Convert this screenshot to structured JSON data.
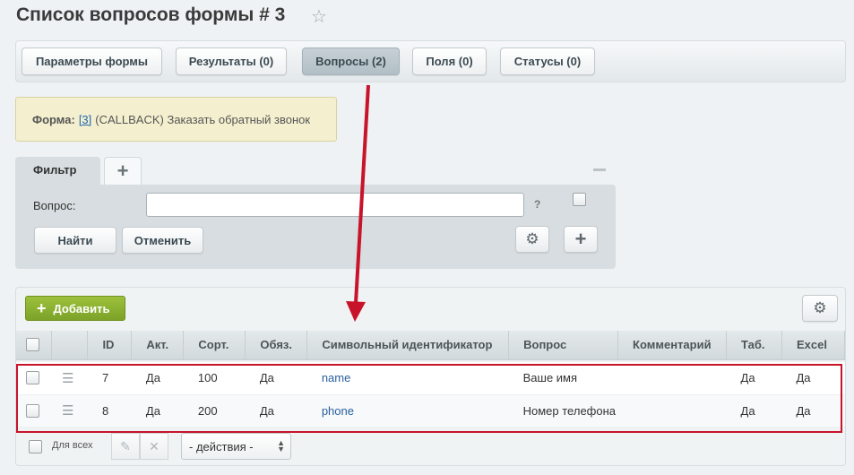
{
  "title": "Список вопросов формы # 3",
  "tabs": [
    {
      "label": "Параметры формы"
    },
    {
      "label": "Результаты (0)"
    },
    {
      "label": "Вопросы (2)"
    },
    {
      "label": "Поля (0)"
    },
    {
      "label": "Статусы (0)"
    }
  ],
  "active_tab": "Вопросы (2)",
  "form_info": {
    "label": "Форма:",
    "id_link": "[3]",
    "text": "(CALLBACK) Заказать обратный звонок"
  },
  "filter": {
    "tab_label": "Фильтр",
    "add_tab_symbol": "+",
    "field_label": "Вопрос:",
    "field_value": "",
    "help": "?",
    "find_label": "Найти",
    "cancel_label": "Отменить"
  },
  "list": {
    "add_label": "Добавить",
    "columns": [
      "ID",
      "Акт.",
      "Сорт.",
      "Обяз.",
      "Символьный идентификатор",
      "Вопрос",
      "Комментарий",
      "Таб.",
      "Excel"
    ],
    "rows": [
      {
        "id": "7",
        "active": "Да",
        "sort": "100",
        "required": "Да",
        "code": "name",
        "question": "Ваше имя",
        "comment": "",
        "tab": "Да",
        "excel": "Да"
      },
      {
        "id": "8",
        "active": "Да",
        "sort": "200",
        "required": "Да",
        "code": "phone",
        "question": "Номер телефона",
        "comment": "",
        "tab": "Да",
        "excel": "Да"
      }
    ],
    "for_all_label": "Для всех",
    "actions_placeholder": "- действия -"
  },
  "colors": {
    "accent_green": "#8db233",
    "highlight_red": "#c8142b"
  },
  "icons": [
    "star-icon",
    "gear-icon",
    "plus-icon",
    "drag-handle-icon",
    "pencil-icon",
    "delete-icon"
  ]
}
